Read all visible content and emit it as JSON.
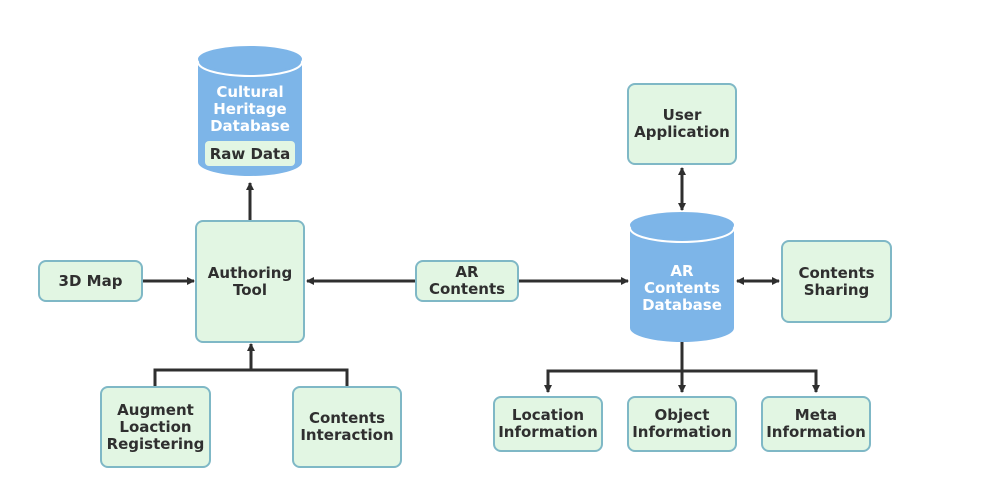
{
  "diagram": {
    "colors": {
      "box_fill": "#e2f6e3",
      "box_border": "#7fb8c6",
      "database_fill": "#7db5e8",
      "arrow": "#2f2f2f",
      "text": "#2f2f2f",
      "database_text": "#ffffff"
    },
    "nodes": {
      "cultural_db": {
        "label": "Cultural\nHeritage\nDatabase",
        "inner_label": "Raw Data"
      },
      "authoring_tool": {
        "label": "Authoring\nTool"
      },
      "map3d": {
        "label": "3D Map"
      },
      "augment": {
        "label": "Augment\nLoaction\nRegistering"
      },
      "contents_interaction": {
        "label": "Contents\nInteraction"
      },
      "ar_contents": {
        "label": "AR\nContents"
      },
      "ar_db": {
        "label": "AR\nContents\nDatabase"
      },
      "user_app": {
        "label": "User\nApplication"
      },
      "contents_sharing": {
        "label": "Contents\nSharing"
      },
      "location_info": {
        "label": "Location\nInformation"
      },
      "object_info": {
        "label": "Object\nInformation"
      },
      "meta_info": {
        "label": "Meta\nInformation"
      }
    },
    "edges": [
      {
        "from": "authoring_tool",
        "to": "cultural_db",
        "direction": "forward"
      },
      {
        "from": "map3d",
        "to": "authoring_tool",
        "direction": "forward"
      },
      {
        "from": "augment",
        "to": "authoring_tool",
        "direction": "forward"
      },
      {
        "from": "contents_interaction",
        "to": "authoring_tool",
        "direction": "forward"
      },
      {
        "from": "ar_contents",
        "to": "authoring_tool",
        "direction": "forward"
      },
      {
        "from": "ar_contents",
        "to": "ar_db",
        "direction": "forward"
      },
      {
        "from": "ar_db",
        "to": "user_app",
        "direction": "both"
      },
      {
        "from": "ar_db",
        "to": "contents_sharing",
        "direction": "both"
      },
      {
        "from": "ar_db",
        "to": "location_info",
        "direction": "forward"
      },
      {
        "from": "ar_db",
        "to": "object_info",
        "direction": "forward"
      },
      {
        "from": "ar_db",
        "to": "meta_info",
        "direction": "forward"
      }
    ]
  }
}
